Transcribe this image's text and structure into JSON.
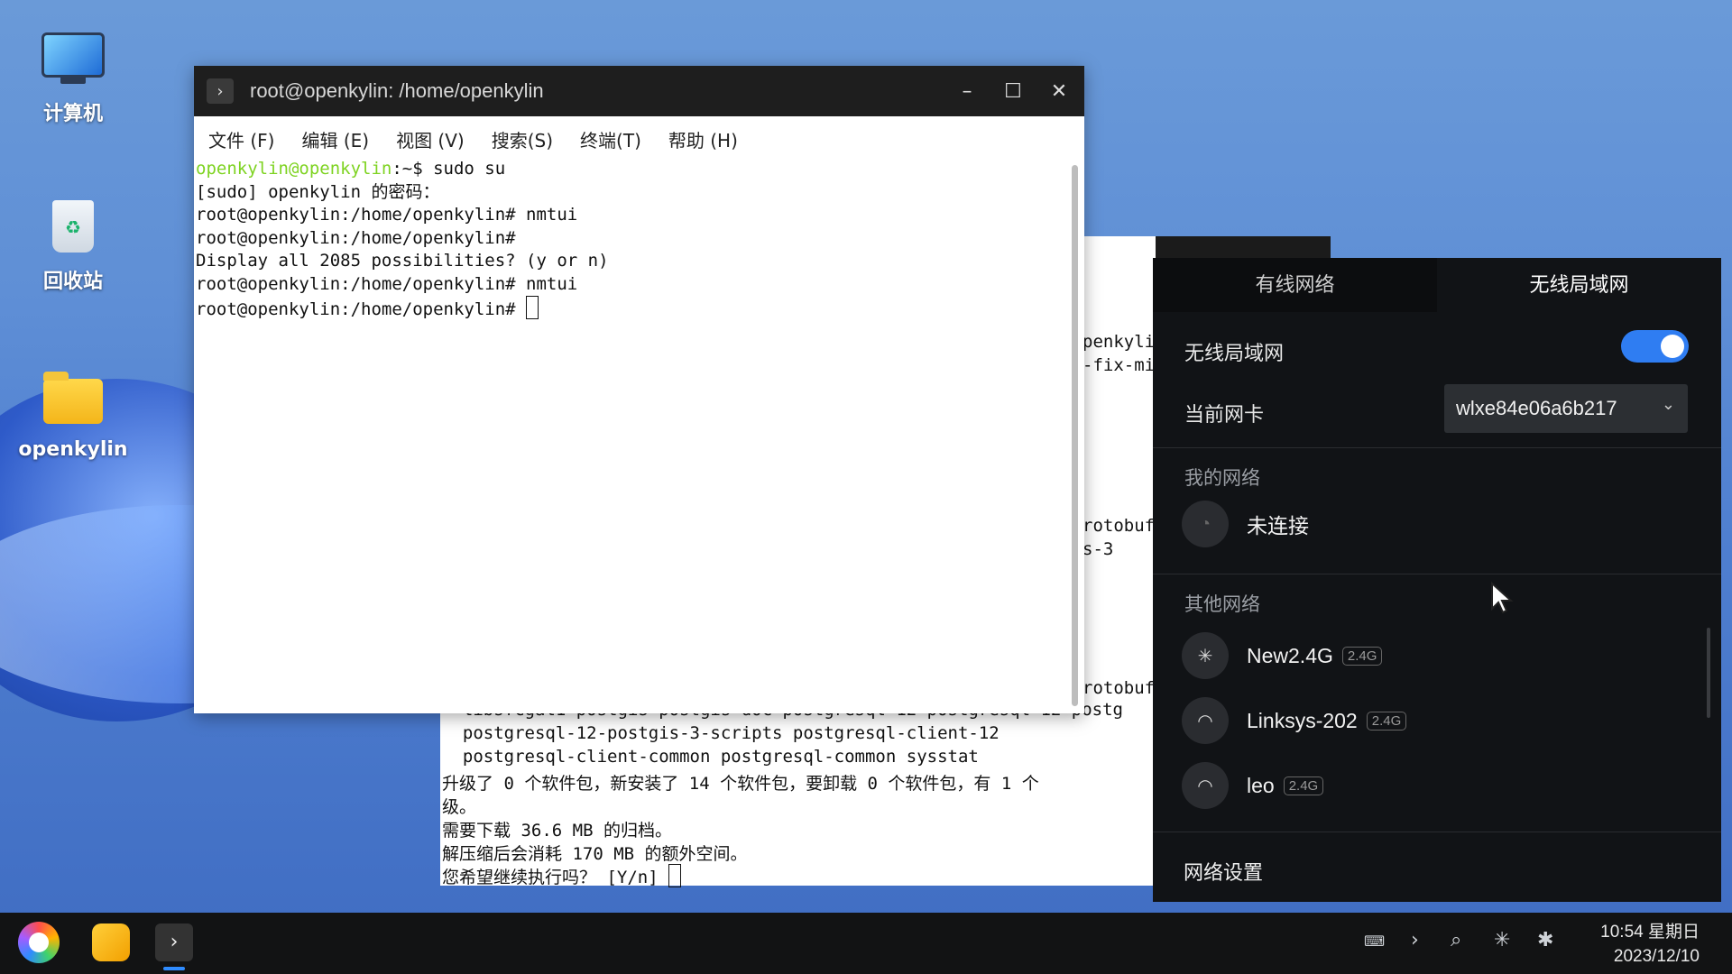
{
  "desktop": {
    "icons": [
      {
        "label": "计算机",
        "icon": "computer-icon"
      },
      {
        "label": "回收站",
        "icon": "trash-icon"
      },
      {
        "label": "openkylin",
        "icon": "home-folder-icon"
      }
    ]
  },
  "background_terminal": {
    "lines": [
      {
        "text": "penkyli"
      },
      {
        "text": "-fix-mi"
      },
      {
        "text": "rotobuf"
      },
      {
        "text": "s-3"
      },
      {
        "text": "rotobuf"
      },
      {
        "text": "  libsfcgal1 postgis postgis-doc postgresql-12 postgresql-12-postg"
      },
      {
        "text": "  postgresql-12-postgis-3-scripts postgresql-client-12"
      },
      {
        "text": "  postgresql-client-common postgresql-common sysstat"
      },
      {
        "text": "升级了 0 个软件包，新安装了 14 个软件包，要卸载 0 个软件包，有 1 个"
      },
      {
        "text": "级。"
      },
      {
        "text": "需要下载 36.6 MB 的归档。"
      },
      {
        "text": "解压缩后会消耗 170 MB 的额外空间。"
      },
      {
        "text": "您希望继续执行吗？ [Y/n] "
      }
    ]
  },
  "terminal": {
    "title": "root@openkylin: /home/openkylin",
    "menu": [
      "文件 (F)",
      "编辑 (E)",
      "视图 (V)",
      "搜索(S)",
      "终端(T)",
      "帮助 (H)"
    ],
    "prompt_user": "openkylin@openkylin",
    "prompt_rest": ":~$ sudo su",
    "lines": [
      "[sudo] openkylin 的密码：",
      "root@openkylin:/home/openkylin# nmtui",
      "root@openkylin:/home/openkylin#",
      "Display all 2085 possibilities? (y or n)",
      "root@openkylin:/home/openkylin# nmtui",
      "root@openkylin:/home/openkylin# "
    ]
  },
  "network_panel": {
    "tabs": [
      "有线网络",
      "无线局域网"
    ],
    "active_tab": "无线局域网",
    "wireless_label": "无线局域网",
    "wireless_enabled": true,
    "nic_label": "当前网卡",
    "nic_value": "wlxe84e06a6b217",
    "my_networks_label": "我的网络",
    "my_network_status": "未连接",
    "other_networks_label": "其他网络",
    "networks": [
      {
        "name": "New2.4G",
        "band": "2.4G",
        "icon": "loading-spinner-icon"
      },
      {
        "name": "Linksys-202",
        "band": "2.4G",
        "icon": "wifi-locked-icon"
      },
      {
        "name": "leo",
        "band": "2.4G",
        "icon": "wifi-locked-icon"
      }
    ],
    "settings_label": "网络设置",
    "accent": "#2f7df2"
  },
  "taskbar": {
    "tray_icons": [
      "keyboard-icon",
      "chevron-right-icon",
      "search-icon",
      "network-loading-icon",
      "bluetooth-icon"
    ],
    "time": "10:54 星期日",
    "date": "2023/12/10"
  }
}
